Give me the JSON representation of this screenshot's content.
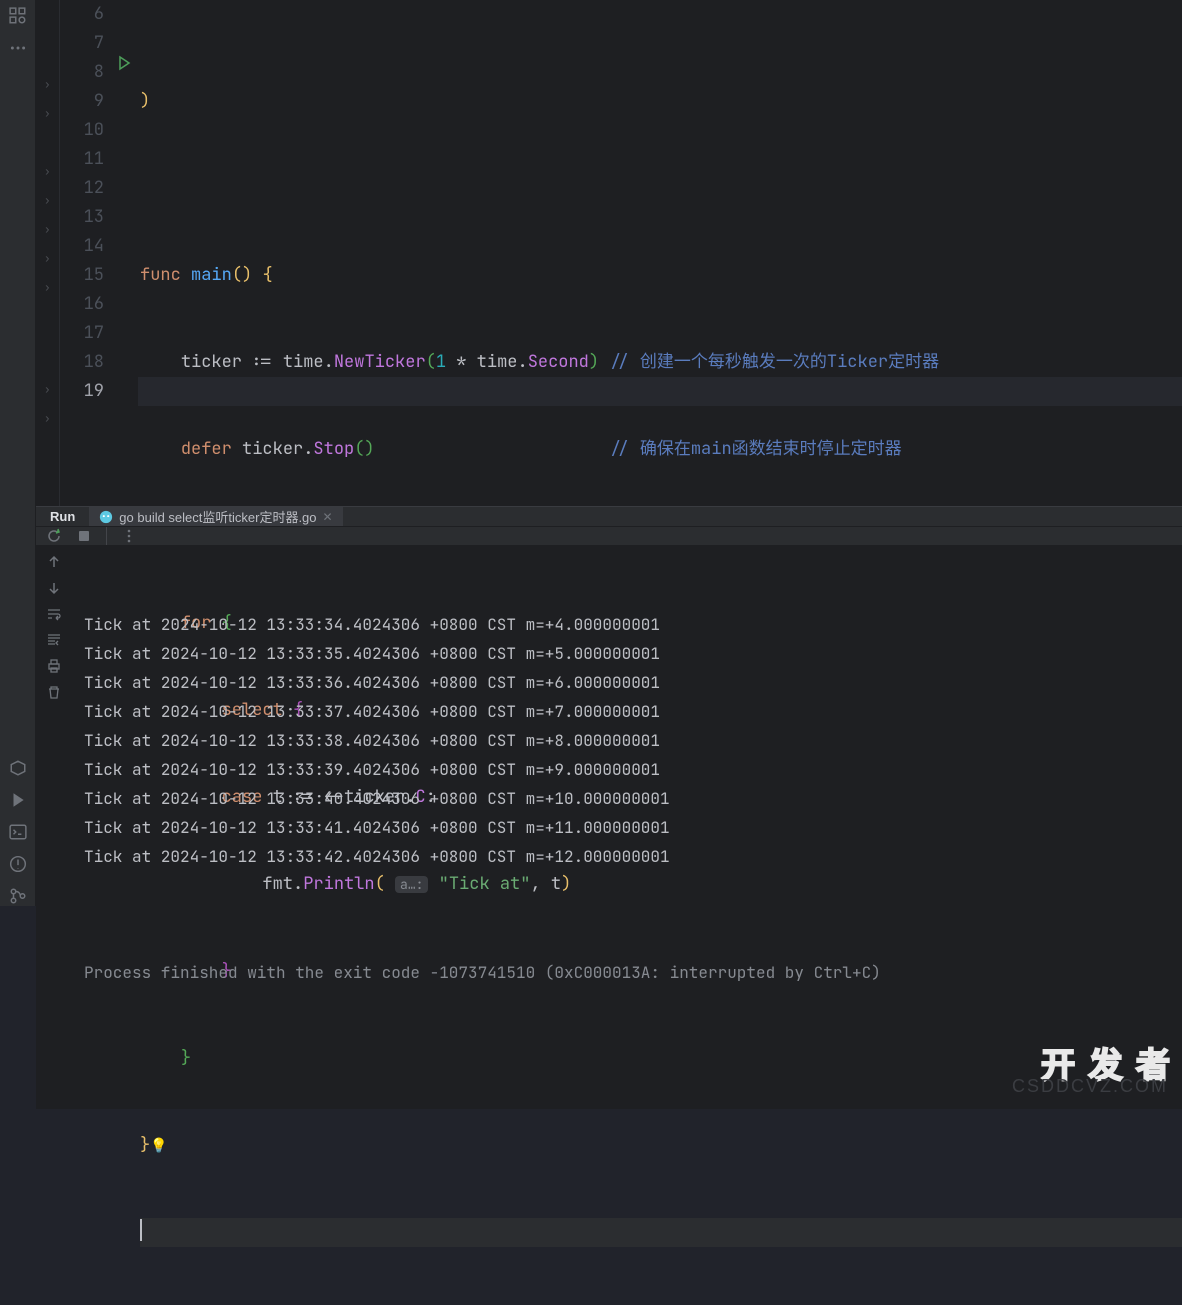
{
  "gutter": {
    "lines": [
      6,
      7,
      8,
      9,
      10,
      11,
      12,
      13,
      14,
      15,
      16,
      17,
      18,
      19
    ],
    "current": 19,
    "run_marker_line": 8
  },
  "code": {
    "l6": {
      "br": ")"
    },
    "l8": {
      "kw1": "func",
      "fn": "main",
      "p": "() {"
    },
    "l9": {
      "id": "ticker",
      "op": ":=",
      "pk1": "time",
      "dot1": ".",
      "ty1": "NewTicker",
      "open": "(",
      "n": "1",
      "mul": " * ",
      "pk2": "time",
      "dot2": ".",
      "ty2": "Second",
      "close": ")",
      "cm": "// 创建一个每秒触发一次的Ticker定时器"
    },
    "l10": {
      "kw": "defer",
      "id": "ticker",
      "dot": ".",
      "ty": "Stop",
      "p": "()",
      "cm": "// 确保在main函数结束时停止定时器"
    },
    "l12": {
      "kw": "for",
      "br": "{"
    },
    "l13": {
      "kw": "select",
      "br": "{"
    },
    "l14": {
      "kw": "case",
      "id1": "t",
      "op": ":=",
      "arrow": "<-",
      "id2": "ticker",
      "dot": ".",
      "fld": "C",
      "colon": ":"
    },
    "l15": {
      "pk": "fmt",
      "dot": ".",
      "ty": "Println",
      "open": "(",
      "hint": "a…:",
      "str": "\"Tick at\"",
      "comma": ", ",
      "id": "t",
      "close": ")"
    },
    "l16": {
      "br": "}"
    },
    "l17": {
      "br": "}"
    },
    "l18": {
      "br": "}"
    }
  },
  "console": {
    "run_label": "Run",
    "tab_label": "go build select监听ticker定时器.go",
    "output": [
      "Tick at 2024-10-12 13:33:34.4024306 +0800 CST m=+4.000000001",
      "Tick at 2024-10-12 13:33:35.4024306 +0800 CST m=+5.000000001",
      "Tick at 2024-10-12 13:33:36.4024306 +0800 CST m=+6.000000001",
      "Tick at 2024-10-12 13:33:37.4024306 +0800 CST m=+7.000000001",
      "Tick at 2024-10-12 13:33:38.4024306 +0800 CST m=+8.000000001",
      "Tick at 2024-10-12 13:33:39.4024306 +0800 CST m=+9.000000001",
      "Tick at 2024-10-12 13:33:40.4024306 +0800 CST m=+10.000000001",
      "Tick at 2024-10-12 13:33:41.4024306 +0800 CST m=+11.000000001",
      "Tick at 2024-10-12 13:33:42.4024306 +0800 CST m=+12.000000001"
    ],
    "final": "Process finished with the exit code -1073741510 (0xC000013A: interrupted by Ctrl+C)"
  },
  "watermark": {
    "w1": "开 发 者",
    "w2": "CSDDCVZ.COM"
  }
}
